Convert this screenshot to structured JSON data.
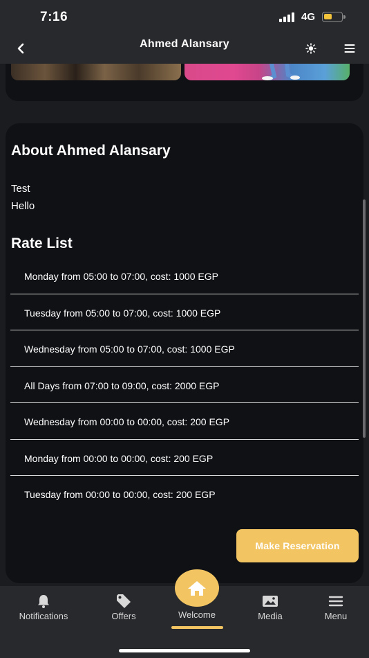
{
  "status_bar": {
    "time": "7:16",
    "network": "4G",
    "battery_level": 0.45,
    "battery_color": "#f3c33b"
  },
  "header": {
    "title": "Ahmed Alansary",
    "back_icon": "chevron-left-icon",
    "theme_icon": "sun-icon",
    "menu_icon": "hamburger-menu-icon"
  },
  "about": {
    "title": "About Ahmed Alansary",
    "lines": [
      "Test",
      "Hello"
    ]
  },
  "rate_list": {
    "title": "Rate List",
    "items": [
      "Monday from 05:00 to 07:00, cost: 1000 EGP",
      "Tuesday from 05:00 to 07:00, cost: 1000 EGP",
      "Wednesday from 05:00 to 07:00, cost: 1000 EGP",
      "All Days from 07:00 to 09:00, cost: 2000 EGP",
      "Wednesday from 00:00 to 00:00, cost: 200 EGP",
      "Monday from 00:00 to 00:00, cost: 200 EGP",
      "Tuesday from 00:00 to 00:00, cost: 200 EGP"
    ]
  },
  "reserve_button": {
    "label": "Make Reservation",
    "color": "#f2c462"
  },
  "tab_bar": {
    "active": "Welcome",
    "accent": "#f2c462",
    "tabs": [
      {
        "label": "Notifications",
        "icon": "bell-icon"
      },
      {
        "label": "Offers",
        "icon": "tag-icon"
      },
      {
        "label": "Welcome",
        "icon": "home-icon"
      },
      {
        "label": "Media",
        "icon": "image-icon"
      },
      {
        "label": "Menu",
        "icon": "hamburger-menu-icon"
      }
    ]
  }
}
